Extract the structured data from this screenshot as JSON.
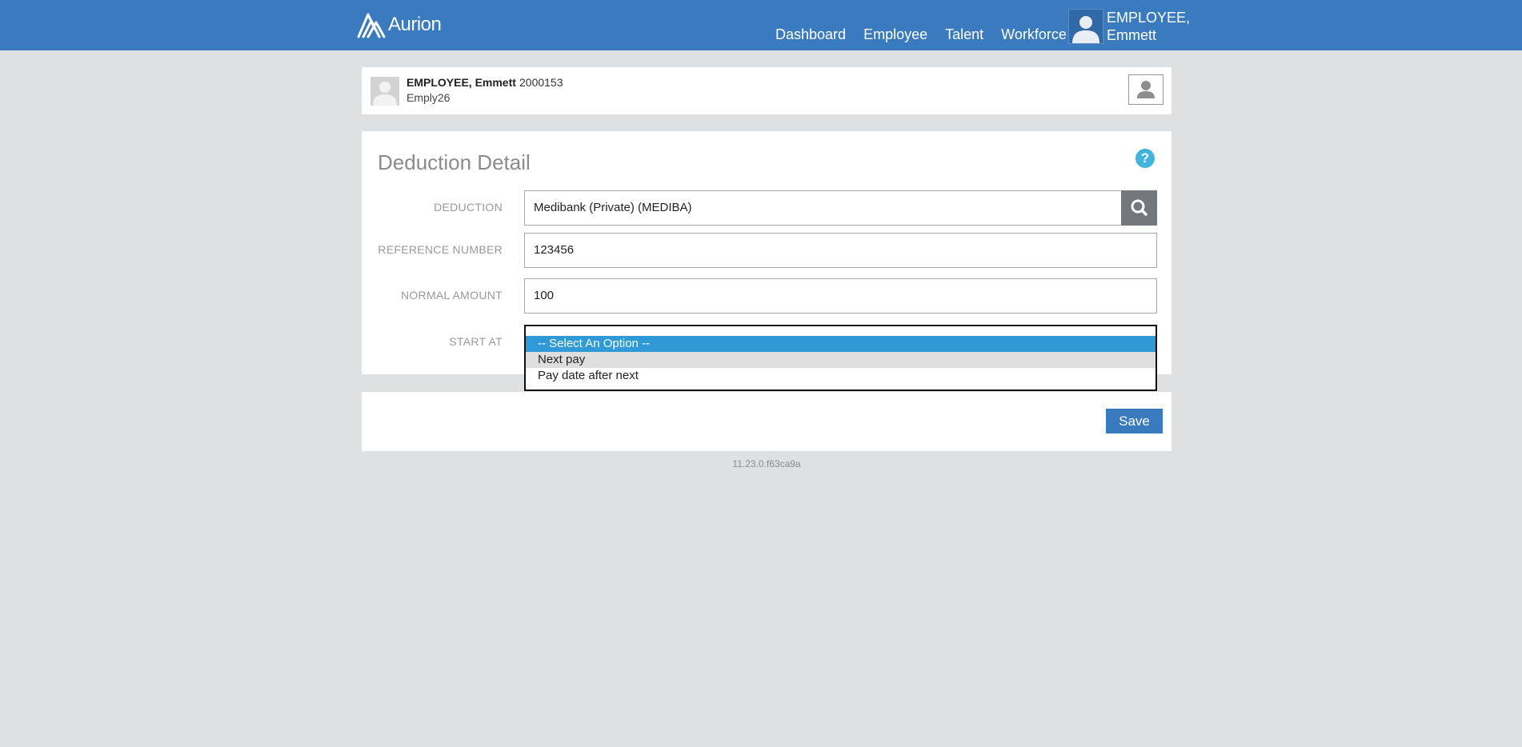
{
  "header": {
    "brand": "Aurion",
    "nav": [
      "Dashboard",
      "Employee",
      "Talent",
      "Workforce"
    ],
    "user_line1": "EMPLOYEE,",
    "user_line2": "Emmett"
  },
  "employee": {
    "name": "EMPLOYEE, Emmett",
    "number": "2000153",
    "code": "Emply26"
  },
  "form": {
    "title": "Deduction Detail",
    "help": "?",
    "deduction_label": "DEDUCTION",
    "deduction_value": "Medibank (Private) (MEDIBA)",
    "reference_label": "REFERENCE NUMBER",
    "reference_value": "123456",
    "amount_label": "NORMAL AMOUNT",
    "amount_value": "100",
    "start_label": "START AT",
    "start_options": [
      "-- Select An Option --",
      "Next pay",
      "Pay date after next"
    ],
    "start_selected_index": 0,
    "start_hover_index": 1
  },
  "footer": {
    "save_label": "Save",
    "version": "11.23.0.f63ca9a"
  },
  "colors": {
    "brand_blue": "#3a7bbf",
    "page_bg": "#dfe0e2",
    "option_selected": "#2f9ad6",
    "help_icon": "#42b3dc"
  }
}
